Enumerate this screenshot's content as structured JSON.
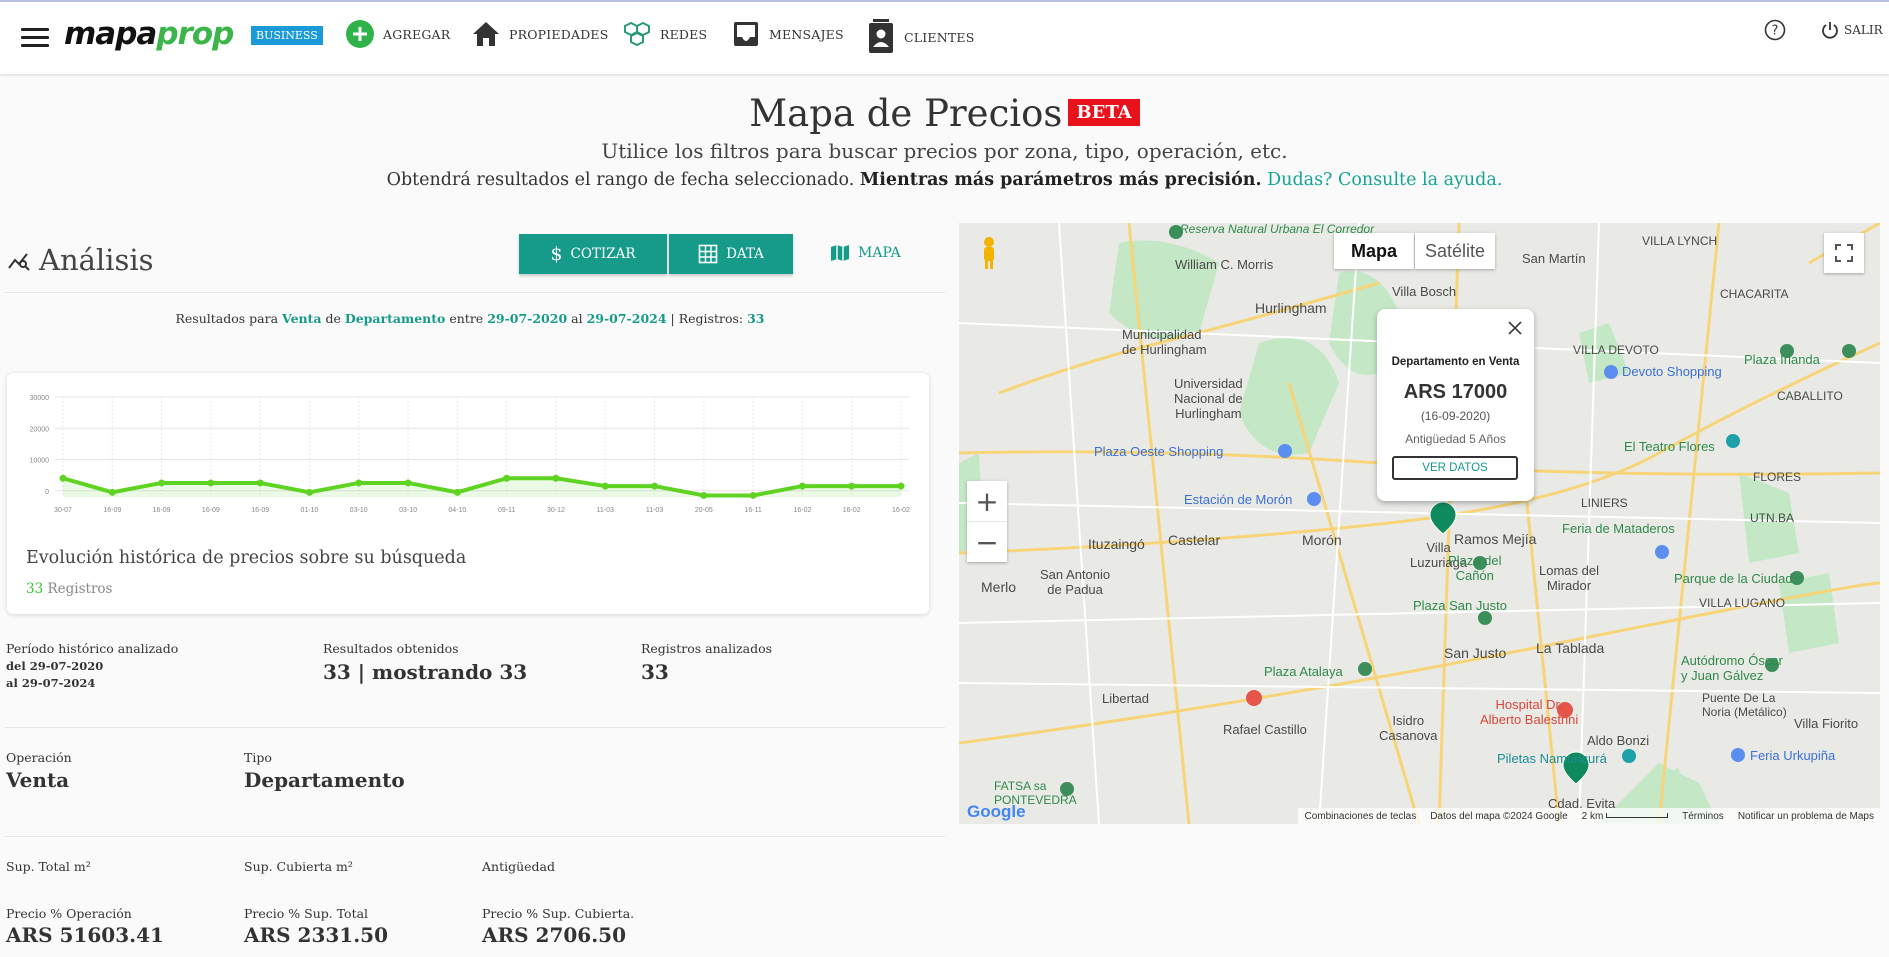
{
  "header": {
    "logo_a": "mapa",
    "logo_b": "prop",
    "badge": "BUSINESS",
    "nav": {
      "agregar": "AGREGAR",
      "propiedades": "PROPIEDADES",
      "redes": "REDES",
      "mensajes": "MENSAJES",
      "clientes": "CLIENTES"
    },
    "salir": "SALIR"
  },
  "hero": {
    "title": "Mapa de Precios",
    "beta": "BETA",
    "subtitle": "Utilice los filtros para buscar precios por zona, tipo, operación, etc.",
    "line2_plain": "Obtendrá resultados el rango de fecha seleccionado.",
    "line2_bold": "Mientras más parámetros más precisión.",
    "line2_link": "Dudas? Consulte la ayuda."
  },
  "analysis": {
    "title": "Análisis",
    "btn_cotizar": "COTIZAR",
    "btn_data": "DATA",
    "btn_mapa": "MAPA",
    "results": {
      "p1": "Resultados para",
      "operacion": "Venta",
      "p2": "de",
      "tipo": "Departamento",
      "p3": "entre",
      "desde": "29-07-2020",
      "p4": "al",
      "hasta": "29-07-2024",
      "p5": "| Registros:",
      "registros": "33"
    }
  },
  "chart_data": {
    "type": "line",
    "color": "#5ed321",
    "x": [
      "30-07",
      "16-09",
      "16-09",
      "16-09",
      "16-09",
      "01-10",
      "03-10",
      "03-10",
      "04-10",
      "09-11",
      "30-12",
      "11-03",
      "11-03",
      "20-05",
      "16-11",
      "16-02",
      "16-02",
      "16-02"
    ],
    "values": [
      4000,
      -500,
      2500,
      2500,
      2500,
      -500,
      2500,
      2500,
      -500,
      4000,
      4000,
      1500,
      1500,
      -1500,
      -1500,
      1500,
      1500,
      1500
    ],
    "yticks": [
      "30000",
      "20000",
      "10000",
      "0"
    ],
    "ylim": [
      -2000,
      30000
    ],
    "grid": true
  },
  "chart_card": {
    "caption": "Evolución histórica de precios sobre su búsqueda",
    "count": "33",
    "count_label": "Registros"
  },
  "stats": {
    "periodo_label": "Período histórico analizado",
    "periodo_desde": "del 29-07-2020",
    "periodo_hasta": "al 29-07-2024",
    "resultados_label": "Resultados obtenidos",
    "resultados_value": "33 | mostrando 33",
    "registros_label": "Registros analizados",
    "registros_value": "33",
    "operacion_label": "Operación",
    "operacion_value": "Venta",
    "tipo_label": "Tipo",
    "tipo_value": "Departamento",
    "sup_total_label": "Sup. Total m²",
    "sup_cubierta_label": "Sup. Cubierta m²",
    "antiguedad_label": "Antigüedad",
    "precio_op_label": "Precio % Operación",
    "precio_op_value": "ARS 51603.41",
    "precio_st_label": "Precio % Sup. Total",
    "precio_st_value": "ARS 2331.50",
    "precio_sc_label": "Precio % Sup. Cubierta.",
    "precio_sc_value": "ARS 2706.50"
  },
  "map": {
    "tab_mapa": "Mapa",
    "tab_satelite": "Satélite",
    "popup": {
      "title": "Departamento en Venta",
      "price": "ARS 17000",
      "date": "(16-09-2020)",
      "age": "Antigüedad 5 Años",
      "button": "VER DATOS"
    },
    "labels": {
      "hurlingham": "Hurlingham",
      "wcmorris": "William\nC. Morris",
      "villabosch": "Villa Bosch",
      "sanmartin": "San Martín",
      "villalynch": "VILLA LYNCH",
      "chacarita": "CHACARITA",
      "villadevoto": "VILLA DEVOTO",
      "devotoshopping": "Devoto Shopping",
      "plazairlanda": "Plaza Irlanda",
      "caballito": "CABALLITO",
      "municipalidad": "Municipalidad\nde Hurlingham",
      "universidad": "Universidad\nNacional de\nHurlingham",
      "plazaoeste": "Plaza Oeste Shopping",
      "estacionmoron": "Estación de Morón",
      "castelar": "Castelar",
      "moron": "Morón",
      "ituzaingo": "Ituzaingó",
      "ramosmejia": "Ramos Mejía",
      "villaluzuriaga": "Villa\nLuzuriaga",
      "plazacanon": "Plaza del\nCañón",
      "lomasmirador": "Lomas del\nMirador",
      "liniers": "LINIERS",
      "flores": "FLORES",
      "ferramataderos": "Feria de Mataderos",
      "teatroflores": "El Teatro Flores",
      "parqueciudad": "Parque de la Ciudad",
      "villalugano": "VILLA LUGANO",
      "merlo": "Merlo",
      "sanantonio": "San Antonio\nde Padua",
      "plazasanjusto": "Plaza San Justo",
      "sanjusto": "San Justo",
      "latablada": "La Tablada",
      "plazaatalaya": "Plaza Atalaya",
      "libertad": "Libertad",
      "rafaelcastillo": "Rafael Castillo",
      "isidrocasanova": "Isidro\nCasanova",
      "hospital": "Hospital Dr.\nAlberto Balestrini",
      "aldobonzi": "Aldo Bonzi",
      "autodromo": "Autódromo Óscar\ny Juan Gálvez",
      "puentenoria": "Puente De La\nNoria (Metálico)",
      "villafiorito": "Villa Fiorito",
      "feriaurkupina": "Feria Urkupiña",
      "piletas": "Piletas Namuncurá",
      "cdadevita": "Cdad. Evita",
      "fatsa": "FATSA sa\nPONTEVEDRA",
      "utnba": "UTN.BA",
      "reserva": "Reserva Natural\nUrbana El Corredor"
    },
    "attribution": {
      "keys": "Combinaciones de teclas",
      "data": "Datos del mapa ©2024 Google",
      "scale": "2 km",
      "terms": "Términos",
      "report": "Notificar un problema de Maps"
    }
  },
  "colors": {
    "teal": "#169b8a",
    "green": "#3bb54a",
    "beta": "#e8111c",
    "badge": "#1a9ad6"
  }
}
